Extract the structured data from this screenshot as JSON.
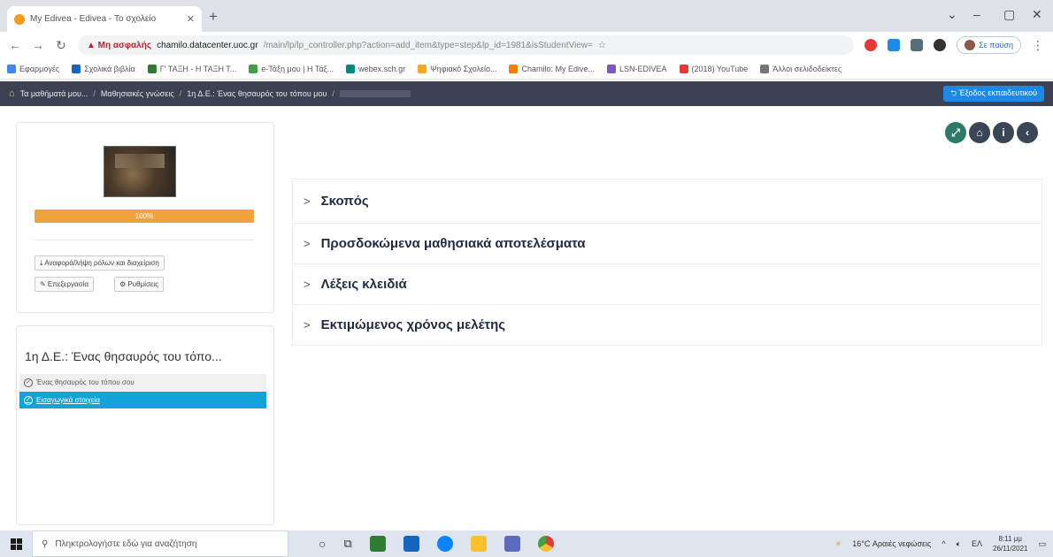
{
  "browser": {
    "tab_title": "My Edivea - Edivea - Το σχολείο",
    "new_tab": "+",
    "window_controls": [
      "⌄",
      "–",
      "▢",
      "✕"
    ],
    "url_warning": "▲ Μη ασφαλής",
    "url_host": "chamilo.datacenter.uoc.gr",
    "url_path": "/main/lp/lp_controller.php?action=add_item&type=step&lp_id=1981&isStudentView=",
    "profile_label": "Σε παύση",
    "bookmarks": [
      {
        "label": "Εφαρμογές",
        "color": "#4285f4"
      },
      {
        "label": "Σχολικά βιβλία",
        "color": "#1565c0"
      },
      {
        "label": "Γ' ΤΑΞΗ - Η ΤΑΞΗ Τ...",
        "color": "#2e7d32"
      },
      {
        "label": "e-Τάξη μου | Η Τάξ...",
        "color": "#43a047"
      },
      {
        "label": "webex.sch.gr",
        "color": "#00897b"
      },
      {
        "label": "Ψηφιακό Σχολείο...",
        "color": "#f9a825"
      },
      {
        "label": "Chamilo: My Edive...",
        "color": "#f57c00"
      },
      {
        "label": "LSN-EDIVEA",
        "color": "#7e57c2"
      },
      {
        "label": "(2018) YouTube",
        "color": "#e53935"
      },
      {
        "label": "Άλλοι σελιδοδείκτες",
        "color": "#757575"
      }
    ]
  },
  "site": {
    "breadcrumb": [
      "Τα μαθήματά μου...",
      "Μαθησιακές γνώσεις",
      "1η Δ.Ε.: Ένας θησαυρός του τόπου μου"
    ],
    "exit_button": "⮌ Έξοδος εκπαιδευτικού"
  },
  "left": {
    "progress_label": "100%",
    "progress_value": 100,
    "btn_download": "⤓ Αναφορά/λήψη ρόλων και διαχείριση",
    "btn_edit": "✎ Επεξεργασία",
    "btn_settings": "⚙ Ρυθμίσεις",
    "lp_title": "1η Δ.Ε.: Ένας θησαυρός του τόπο...",
    "lp_items": [
      {
        "label": "Ένας θησαυρός του τόπου σου",
        "active": false
      },
      {
        "label": "Εισαγωγικά στοιχεία",
        "active": true
      }
    ]
  },
  "tool_icons": [
    {
      "name": "expand-icon",
      "glyph": "⤢"
    },
    {
      "name": "home-icon",
      "glyph": "⌂"
    },
    {
      "name": "info-icon",
      "glyph": "i"
    },
    {
      "name": "back-icon",
      "glyph": "‹"
    }
  ],
  "accordion": [
    {
      "label": "Σκοπός"
    },
    {
      "label": "Προσδοκώμενα μαθησιακά αποτελέσματα"
    },
    {
      "label": "Λέξεις κλειδιά"
    },
    {
      "label": "Εκτιμώμενος χρόνος μελέτης"
    }
  ],
  "taskbar": {
    "search_placeholder": "Πληκτρολογήστε εδώ για αναζήτηση",
    "weather": "16°C Αραιές νεφώσεις",
    "lang": "ΕΛ",
    "time": "8:11 μμ",
    "date": "26/11/2021"
  }
}
